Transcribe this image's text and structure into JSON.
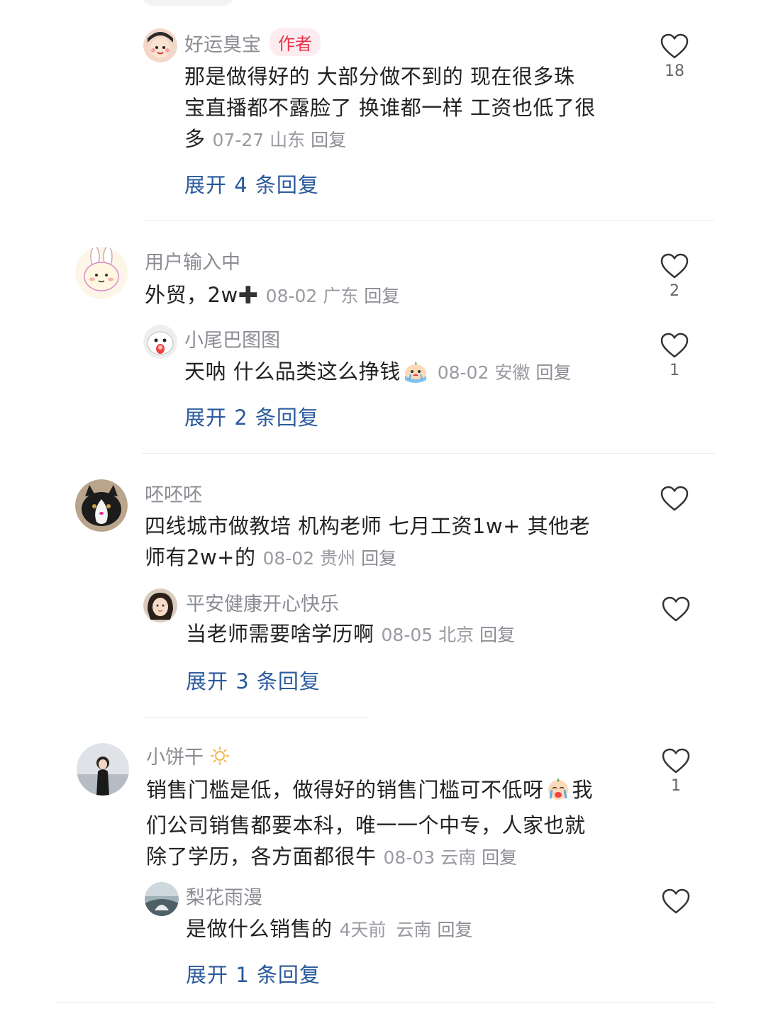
{
  "comments": [
    {
      "user": "好运臭宝",
      "badge": "作者",
      "lines": [
        "那是做得好的 大部分做不到的 现在很多珠",
        "宝直播都不露脸了 换谁都一样 工资也低了很"
      ],
      "last_line": "多",
      "date": "07-27",
      "location": "山东",
      "reply_label": "回复",
      "likes": "18",
      "expand": "展开 4 条回复"
    },
    {
      "user": "用户输入中",
      "text": "外贸，2w",
      "date": "08-02",
      "location": "广东",
      "reply_label": "回复",
      "likes": "2",
      "reply": {
        "user": "小尾巴图图",
        "text": "天呐 什么品类这么挣钱",
        "date": "08-02",
        "location": "安徽",
        "reply_label": "回复",
        "likes": "1"
      },
      "expand": "展开 2 条回复"
    },
    {
      "user": "呸呸呸",
      "lines": [
        "四线城市做教培 机构老师 七月工资1w+ 其他老"
      ],
      "last_line": "师有2w+的",
      "date": "08-02",
      "location": "贵州",
      "reply_label": "回复",
      "likes": "",
      "reply": {
        "user": "平安健康开心快乐",
        "text": "当老师需要啥学历啊",
        "date": "08-05",
        "location": "北京",
        "reply_label": "回复",
        "likes": ""
      },
      "expand": "展开 3 条回复"
    },
    {
      "user": "小饼干",
      "line1": "销售门槛是低，做得好的销售门槛可不低呀",
      "line1_end": "我",
      "line2": "们公司销售都要本科，唯一一个中专，人家也就",
      "last_line": "除了学历，各方面都很牛",
      "date": "08-03",
      "location": "云南",
      "reply_label": "回复",
      "likes": "1",
      "reply": {
        "user": "梨花雨漫",
        "text": "是做什么销售的",
        "date": "4天前",
        "location": "云南",
        "reply_label": "回复",
        "likes": ""
      },
      "expand": "展开 1 条回复"
    }
  ],
  "colors": {
    "expand_link": "#2a5a9c",
    "author_badge_bg": "#fdecef",
    "author_badge_text": "#e8344e",
    "meta_text": "#9a9aa2"
  }
}
